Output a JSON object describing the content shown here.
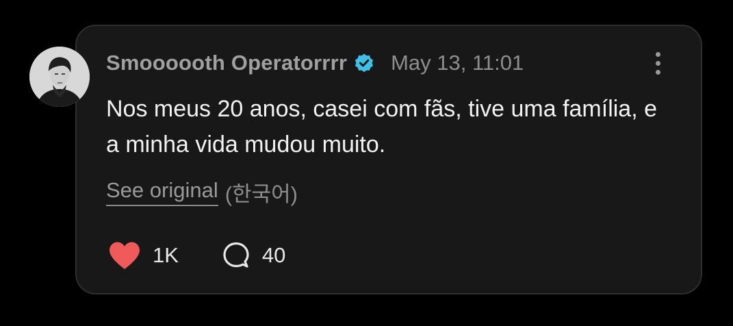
{
  "post": {
    "author": "Smoooooth Operatorrrr",
    "verified": true,
    "timestamp": "May 13, 11:01",
    "text": "Nos meus 20 anos, casei com fãs, tive uma família, e a minha vida mudou muito.",
    "see_original": "See original",
    "original_language": "(한국어)",
    "likes": "1K",
    "replies": "40"
  },
  "colors": {
    "background": "#000000",
    "card": "#181818",
    "verified_badge": "#3ec1e8",
    "heart": "#f05a5a"
  },
  "icons": {
    "avatar": "avatar",
    "verified": "verified-badge-icon",
    "more": "more-vertical-icon",
    "like": "heart-icon",
    "reply": "speech-bubble-icon"
  }
}
